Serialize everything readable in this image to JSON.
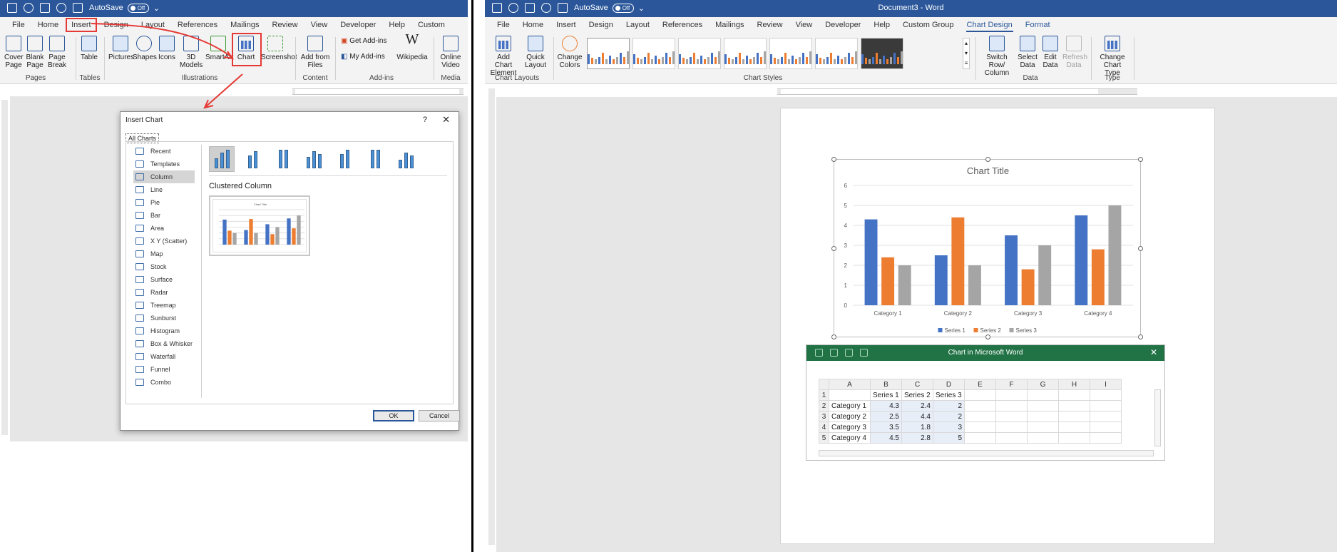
{
  "left": {
    "qat_autosave_label": "AutoSave",
    "qat_autosave_state": "Off",
    "tabs": [
      "File",
      "Home",
      "Insert",
      "Design",
      "Layout",
      "References",
      "Mailings",
      "Review",
      "View",
      "Developer",
      "Help",
      "Custom Group"
    ],
    "ribbon": {
      "pages": [
        "Cover Page",
        "Blank Page",
        "Page Break"
      ],
      "table": "Table",
      "illustrations": [
        "Pictures",
        "Shapes",
        "Icons",
        "3D Models",
        "SmartArt",
        "Chart",
        "Screenshot"
      ],
      "content": "Add from Files",
      "addins": [
        "Get Add-ins",
        "My Add-ins"
      ],
      "wikipedia": "Wikipedia",
      "media": "Online Video",
      "groups": [
        "Pages",
        "Tables",
        "Illustrations",
        "Content",
        "Add-ins",
        "Media"
      ]
    },
    "dialog": {
      "title": "Insert Chart",
      "help": "?",
      "close": "✕",
      "tab": "All Charts",
      "categories": [
        "Recent",
        "Templates",
        "Column",
        "Line",
        "Pie",
        "Bar",
        "Area",
        "X Y (Scatter)",
        "Map",
        "Stock",
        "Surface",
        "Radar",
        "Treemap",
        "Sunburst",
        "Histogram",
        "Box & Whisker",
        "Waterfall",
        "Funnel",
        "Combo"
      ],
      "selected_category": "Column",
      "selected_type": "Clustered Column",
      "preview_title": "Chart Title",
      "ok": "OK",
      "cancel": "Cancel"
    }
  },
  "right": {
    "qat_autosave_label": "AutoSave",
    "qat_autosave_state": "Off",
    "doc_title": "Document3 - Word",
    "tabs": [
      "File",
      "Home",
      "Insert",
      "Design",
      "Layout",
      "References",
      "Mailings",
      "Review",
      "View",
      "Developer",
      "Help",
      "Custom Group",
      "Chart Design",
      "Format"
    ],
    "ribbon": {
      "add_chart_element": "Add Chart Element",
      "quick_layout": "Quick Layout",
      "change_colors": "Change Colors",
      "switch_row_col": "Switch Row/ Column",
      "select_data": "Select Data",
      "edit_data": "Edit Data",
      "refresh_data": "Refresh Data",
      "change_chart_type": "Change Chart Type",
      "groups": [
        "Chart Layouts",
        "Chart Styles",
        "Data",
        "Type"
      ]
    },
    "sheet": {
      "title": "Chart in Microsoft Word",
      "close": "✕",
      "col_headers": [
        "",
        "A",
        "B",
        "C",
        "D",
        "E",
        "F",
        "G",
        "H",
        "I"
      ],
      "rows": [
        [
          "1",
          "",
          "Series 1",
          "Series 2",
          "Series 3",
          "",
          "",
          "",
          "",
          ""
        ],
        [
          "2",
          "Category 1",
          "4.3",
          "2.4",
          "2",
          "",
          "",
          "",
          "",
          ""
        ],
        [
          "3",
          "Category 2",
          "2.5",
          "4.4",
          "2",
          "",
          "",
          "",
          "",
          ""
        ],
        [
          "4",
          "Category 3",
          "3.5",
          "1.8",
          "3",
          "",
          "",
          "",
          "",
          ""
        ],
        [
          "5",
          "Category 4",
          "4.5",
          "2.8",
          "5",
          "",
          "",
          "",
          "",
          ""
        ]
      ]
    }
  },
  "chart_data": {
    "type": "bar",
    "title": "Chart Title",
    "categories": [
      "Category 1",
      "Category 2",
      "Category 3",
      "Category 4"
    ],
    "series": [
      {
        "name": "Series 1",
        "values": [
          4.3,
          2.5,
          3.5,
          4.5
        ],
        "color": "#4472c4"
      },
      {
        "name": "Series 2",
        "values": [
          2.4,
          4.4,
          1.8,
          2.8
        ],
        "color": "#ed7d31"
      },
      {
        "name": "Series 3",
        "values": [
          2,
          2,
          3,
          5
        ],
        "color": "#a5a5a5"
      }
    ],
    "ylim": [
      0,
      6
    ],
    "yticks": [
      "0",
      "1",
      "2",
      "3",
      "4",
      "5",
      "6"
    ],
    "legend": "bottom",
    "grid": true
  }
}
